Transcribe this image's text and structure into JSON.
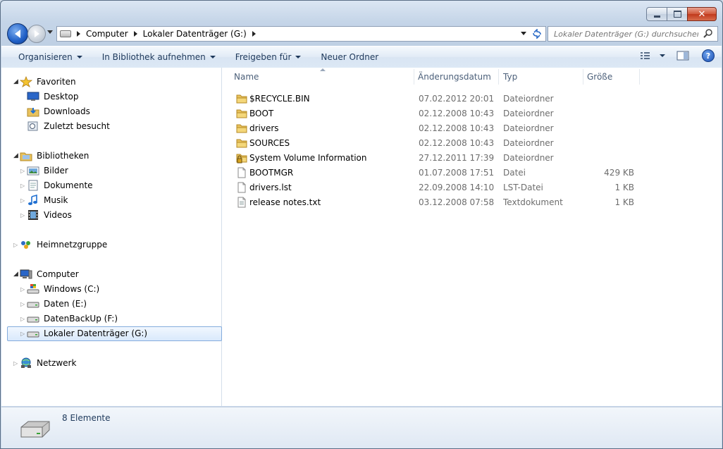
{
  "window": {
    "caption_buttons": [
      "minimize",
      "maximize",
      "close"
    ]
  },
  "nav": {
    "breadcrumbs": [
      "Computer",
      "Lokaler Datenträger (G:)"
    ],
    "search_placeholder": "Lokaler Datenträger (G:) durchsuchen"
  },
  "toolbar": {
    "organize": "Organisieren",
    "library": "In Bibliothek aufnehmen",
    "share": "Freigeben für",
    "new_folder": "Neuer Ordner",
    "help": "?"
  },
  "sidebar": {
    "favorites": {
      "label": "Favoriten",
      "items": [
        "Desktop",
        "Downloads",
        "Zuletzt besucht"
      ]
    },
    "libraries": {
      "label": "Bibliotheken",
      "items": [
        "Bilder",
        "Dokumente",
        "Musik",
        "Videos"
      ]
    },
    "homegroup": {
      "label": "Heimnetzgruppe"
    },
    "computer": {
      "label": "Computer",
      "items": [
        "Windows (C:)",
        "Daten (E:)",
        "DatenBackUp (F:)",
        "Lokaler Datenträger (G:)"
      ],
      "selected": "Lokaler Datenträger (G:)"
    },
    "network": {
      "label": "Netzwerk"
    }
  },
  "file_list": {
    "columns": {
      "name": "Name",
      "date": "Änderungsdatum",
      "type": "Typ",
      "size": "Größe"
    },
    "rows": [
      {
        "name": "$RECYCLE.BIN",
        "date": "07.02.2012 20:01",
        "type": "Dateiordner",
        "size": "",
        "icon": "folder-icon"
      },
      {
        "name": "BOOT",
        "date": "02.12.2008 10:43",
        "type": "Dateiordner",
        "size": "",
        "icon": "folder-icon"
      },
      {
        "name": "drivers",
        "date": "02.12.2008 10:43",
        "type": "Dateiordner",
        "size": "",
        "icon": "folder-icon"
      },
      {
        "name": "SOURCES",
        "date": "02.12.2008 10:43",
        "type": "Dateiordner",
        "size": "",
        "icon": "folder-icon"
      },
      {
        "name": "System Volume Information",
        "date": "27.12.2011 17:39",
        "type": "Dateiordner",
        "size": "",
        "icon": "locked-folder-icon"
      },
      {
        "name": "BOOTMGR",
        "date": "01.07.2008 17:51",
        "type": "Datei",
        "size": "429 KB",
        "icon": "file-icon"
      },
      {
        "name": "drivers.lst",
        "date": "22.09.2008 14:10",
        "type": "LST-Datei",
        "size": "1 KB",
        "icon": "file-icon"
      },
      {
        "name": "release notes.txt",
        "date": "03.12.2008 07:58",
        "type": "Textdokument",
        "size": "1 KB",
        "icon": "text-file-icon"
      }
    ]
  },
  "details": {
    "count": "8 Elemente"
  }
}
